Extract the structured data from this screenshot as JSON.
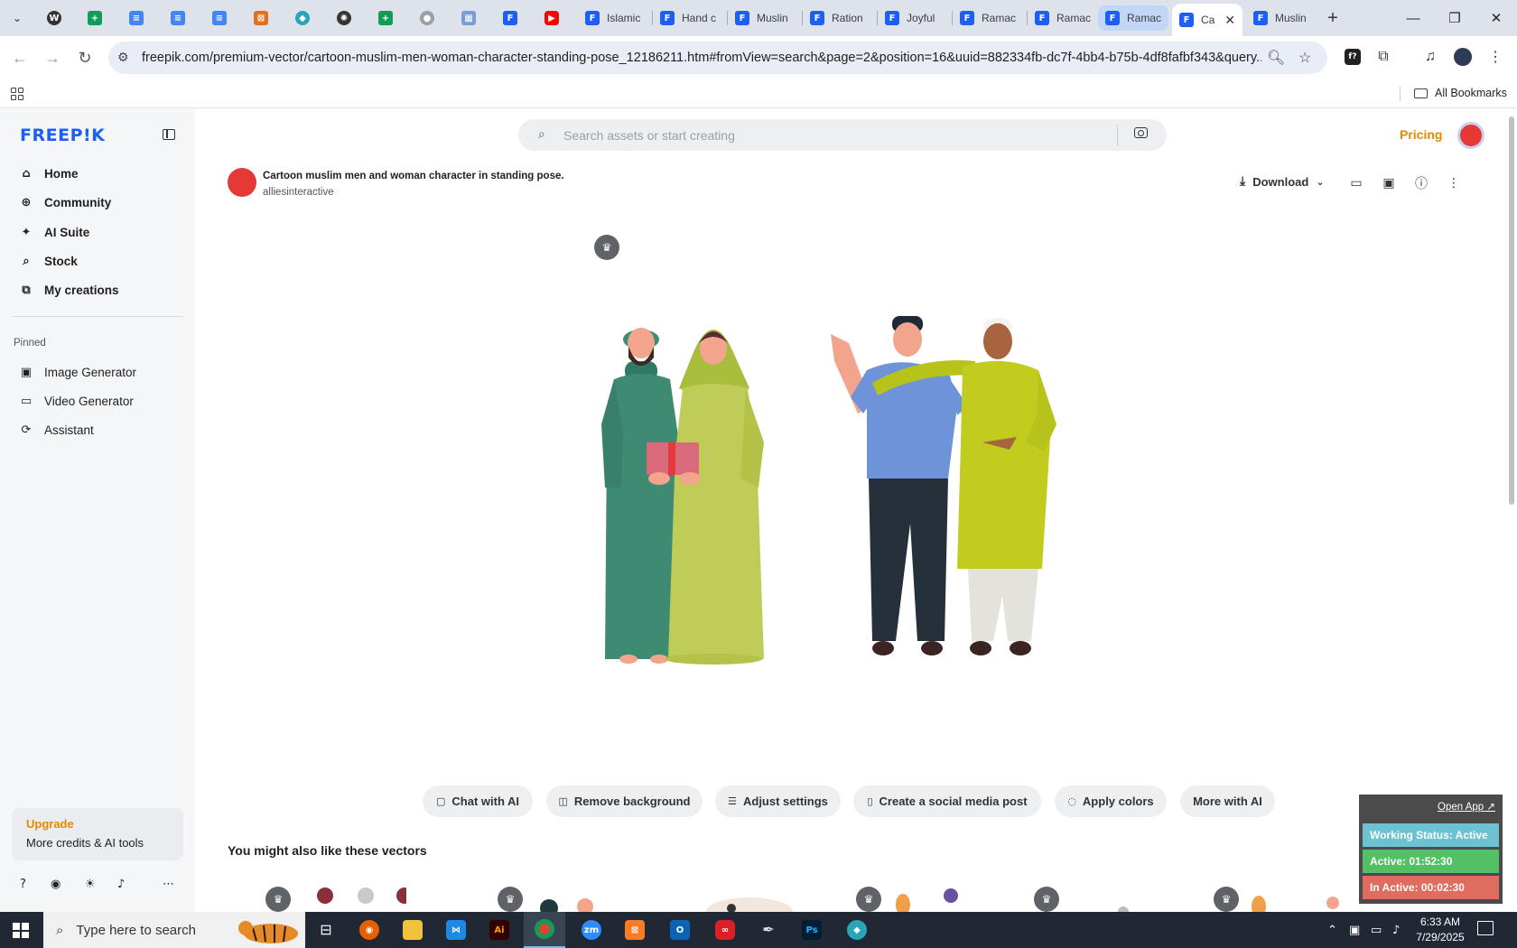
{
  "browser": {
    "tab_titles": [
      "Islamic",
      "Hand c",
      "Muslin",
      "Ration",
      "Joyful",
      "Ramac",
      "Ramac",
      "Ramac",
      "Ca",
      "Muslin"
    ],
    "url": "freepik.com/premium-vector/cartoon-muslim-men-woman-character-standing-pose_12186211.htm#fromView=search&page=2&position=16&uuid=882334fb-dc7f-4bb4-b75b-4df8fafbf343&query...",
    "all_bookmarks": "All Bookmarks"
  },
  "sidebar": {
    "logo": "FREEP!K",
    "nav": [
      "Home",
      "Community",
      "AI Suite",
      "Stock",
      "My creations"
    ],
    "pinned_label": "Pinned",
    "pinned": [
      "Image Generator",
      "Video Generator",
      "Assistant"
    ],
    "upgrade_title": "Upgrade",
    "upgrade_sub": "More credits & AI tools"
  },
  "header": {
    "search_placeholder": "Search assets or start creating",
    "pricing": "Pricing"
  },
  "asset": {
    "title": "Cartoon muslim men and woman character in standing pose.",
    "author": "alliesinteractive",
    "download": "Download"
  },
  "ai_actions": [
    "Chat with AI",
    "Remove background",
    "Adjust settings",
    "Create a social media post",
    "Apply colors",
    "More with AI"
  ],
  "related_heading": "You might also like these vectors",
  "widget": {
    "open_app": "Open App ↗",
    "status": "Working Status: Active",
    "active": "Active: 01:52:30",
    "inactive": "In Active: 00:02:30"
  },
  "taskbar": {
    "search_placeholder": "Type here to search",
    "time": "6:33 AM",
    "date": "7/29/2025"
  }
}
